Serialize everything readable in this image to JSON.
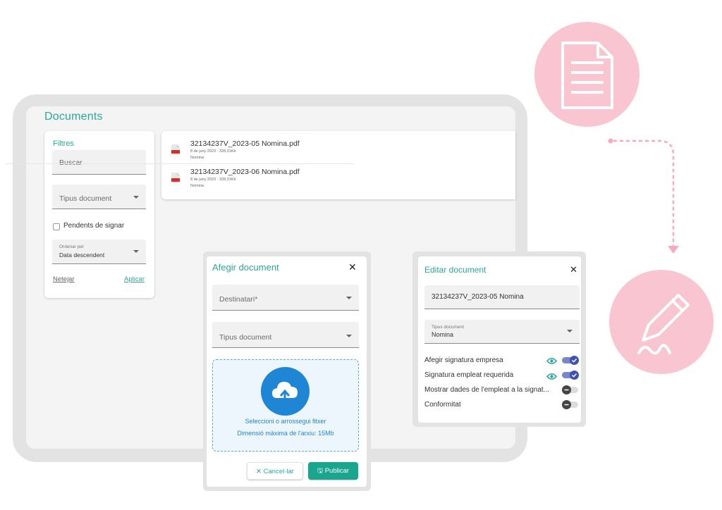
{
  "page_title": "Documents",
  "filters": {
    "title": "Filtres",
    "search_placeholder": "Buscar",
    "doc_type_label": "Tipus document",
    "pending_label": "Pendents de signar",
    "sort_label": "Ordenar per",
    "sort_value": "Data descendent",
    "clear_label": "Netejar",
    "apply_label": "Aplicar"
  },
  "documents": [
    {
      "name": "32134237V_2023-05 Nomina.pdf",
      "meta": "8 de juny 2023 · 328,31Kb",
      "type": "Nomina",
      "icon": "pdf-icon"
    },
    {
      "name": "32134237V_2023-06 Nomina.pdf",
      "meta": "8 de juny 2023 · 328,31Kb",
      "type": "Nomina",
      "icon": "pdf-icon"
    }
  ],
  "add_dialog": {
    "title": "Afegir document",
    "recipient_label": "Destinatari*",
    "doc_type_label": "Tipus document",
    "drop_text": "Seleccioni o arrossegui fitxer",
    "max_size_text": "Dimensió màxima de l'arxiu: 15Mb",
    "cancel_label": "Cancel·lar",
    "publish_label": "Publicar"
  },
  "edit_dialog": {
    "title": "Editar document",
    "name_value": "32134237V_2023-05 Nomina",
    "doc_type_label": "Tipus document",
    "doc_type_value": "Nomina",
    "options": [
      {
        "label": "Afegir signatura empresa",
        "enabled": true,
        "visible_icon": true
      },
      {
        "label": "Signatura empleat requerida",
        "enabled": true,
        "visible_icon": true
      },
      {
        "label": "Mostrar dades de l'empleat a la signat...",
        "enabled": false,
        "visible_icon": false
      },
      {
        "label": "Conformitat",
        "enabled": false,
        "visible_icon": false
      }
    ]
  },
  "colors": {
    "accent": "#2aa89a",
    "primary_blue": "#1f86d6",
    "toggle_on": "#5c6bc0",
    "pink": "#f9c5d1"
  }
}
